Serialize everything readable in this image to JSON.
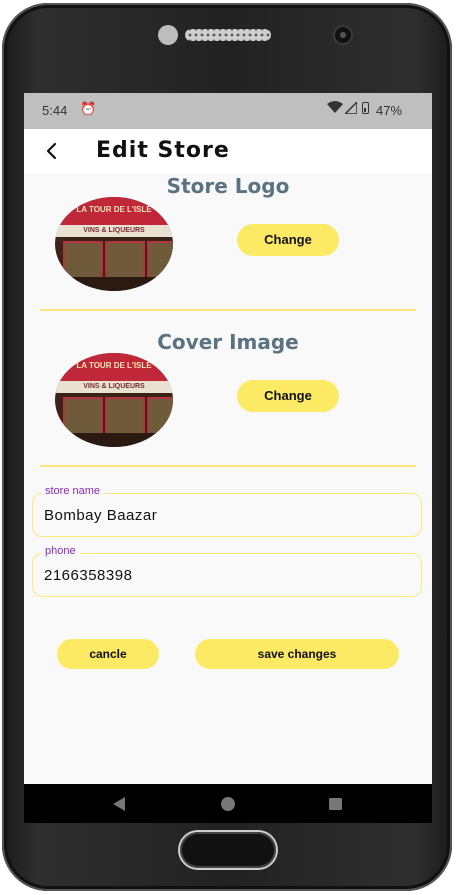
{
  "status_bar": {
    "time": "5:44",
    "battery": "47%",
    "icons": [
      "alarm-icon",
      "wifi-icon",
      "signal-icon",
      "battery-icon"
    ]
  },
  "app_bar": {
    "title": "Edit Store",
    "back_icon": "arrow-back-icon"
  },
  "store_logo": {
    "title": "Store Logo",
    "change_label": "Change"
  },
  "cover_image": {
    "title": "Cover Image",
    "change_label": "Change"
  },
  "form": {
    "store_name": {
      "label": "store name",
      "value": "Bombay Baazar"
    },
    "phone": {
      "label": "phone",
      "value": "2166358398"
    }
  },
  "actions": {
    "cancel_label": "cancle",
    "save_label": "save changes"
  },
  "colors": {
    "accent_yellow": "#fdea64",
    "section_title": "#5a7381",
    "field_label": "#8a2ab8",
    "divider": "#fde77b"
  },
  "nav_bar": {
    "icons": [
      "nav-back-icon",
      "nav-home-icon",
      "nav-recent-icon"
    ]
  }
}
